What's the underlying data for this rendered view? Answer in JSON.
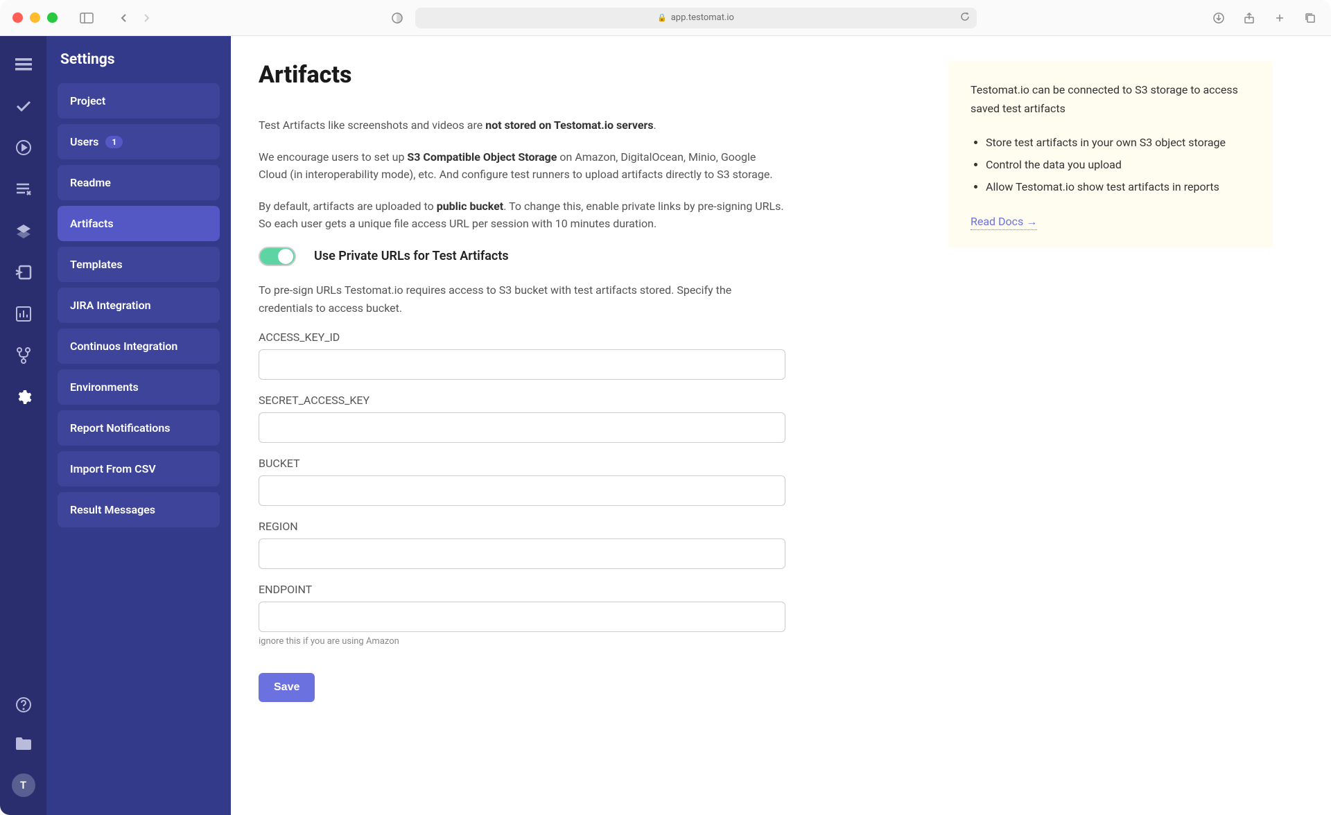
{
  "browser": {
    "url": "app.testomat.io"
  },
  "sidebar": {
    "title": "Settings",
    "items": [
      {
        "label": "Project"
      },
      {
        "label": "Users",
        "badge": "1"
      },
      {
        "label": "Readme"
      },
      {
        "label": "Artifacts",
        "active": true
      },
      {
        "label": "Templates"
      },
      {
        "label": "JIRA Integration"
      },
      {
        "label": "Continuos Integration"
      },
      {
        "label": "Environments"
      },
      {
        "label": "Report Notifications"
      },
      {
        "label": "Import From CSV"
      },
      {
        "label": "Result Messages"
      }
    ]
  },
  "page": {
    "title": "Artifacts",
    "desc1_prefix": "Test Artifacts like screenshots and videos are ",
    "desc1_bold": "not stored on Testomat.io servers",
    "desc1_suffix": ".",
    "desc2_prefix": "We encourage users to set up ",
    "desc2_bold": "S3 Compatible Object Storage",
    "desc2_suffix": " on Amazon, DigitalOcean, Minio, Google Cloud (in interoperability mode), etc. And configure test runners to upload artifacts directly to S3 storage.",
    "desc3_prefix": "By default, artifacts are uploaded to ",
    "desc3_bold": "public bucket",
    "desc3_suffix": ". To change this, enable private links by pre-signing URLs. So each user gets a unique file access URL per session with 10 minutes duration.",
    "toggle_label": "Use Private URLs for Test Artifacts",
    "desc4": "To pre-sign URLs Testomat.io requires access to S3 bucket with test artifacts stored. Specify the credentials to access bucket.",
    "fields": {
      "access_key_id": {
        "label": "ACCESS_KEY_ID",
        "value": ""
      },
      "secret_access_key": {
        "label": "SECRET_ACCESS_KEY",
        "value": ""
      },
      "bucket": {
        "label": "BUCKET",
        "value": ""
      },
      "region": {
        "label": "REGION",
        "value": ""
      },
      "endpoint": {
        "label": "ENDPOINT",
        "value": "",
        "hint": "ignore this if you are using Amazon"
      }
    },
    "save_label": "Save"
  },
  "infobox": {
    "text": "Testomat.io can be connected to S3 storage to access saved test artifacts",
    "bullets": [
      "Store test artifacts in your own S3 object storage",
      "Control the data you upload",
      "Allow Testomat.io show test artifacts in reports"
    ],
    "link": "Read Docs →"
  },
  "avatar_letter": "T"
}
